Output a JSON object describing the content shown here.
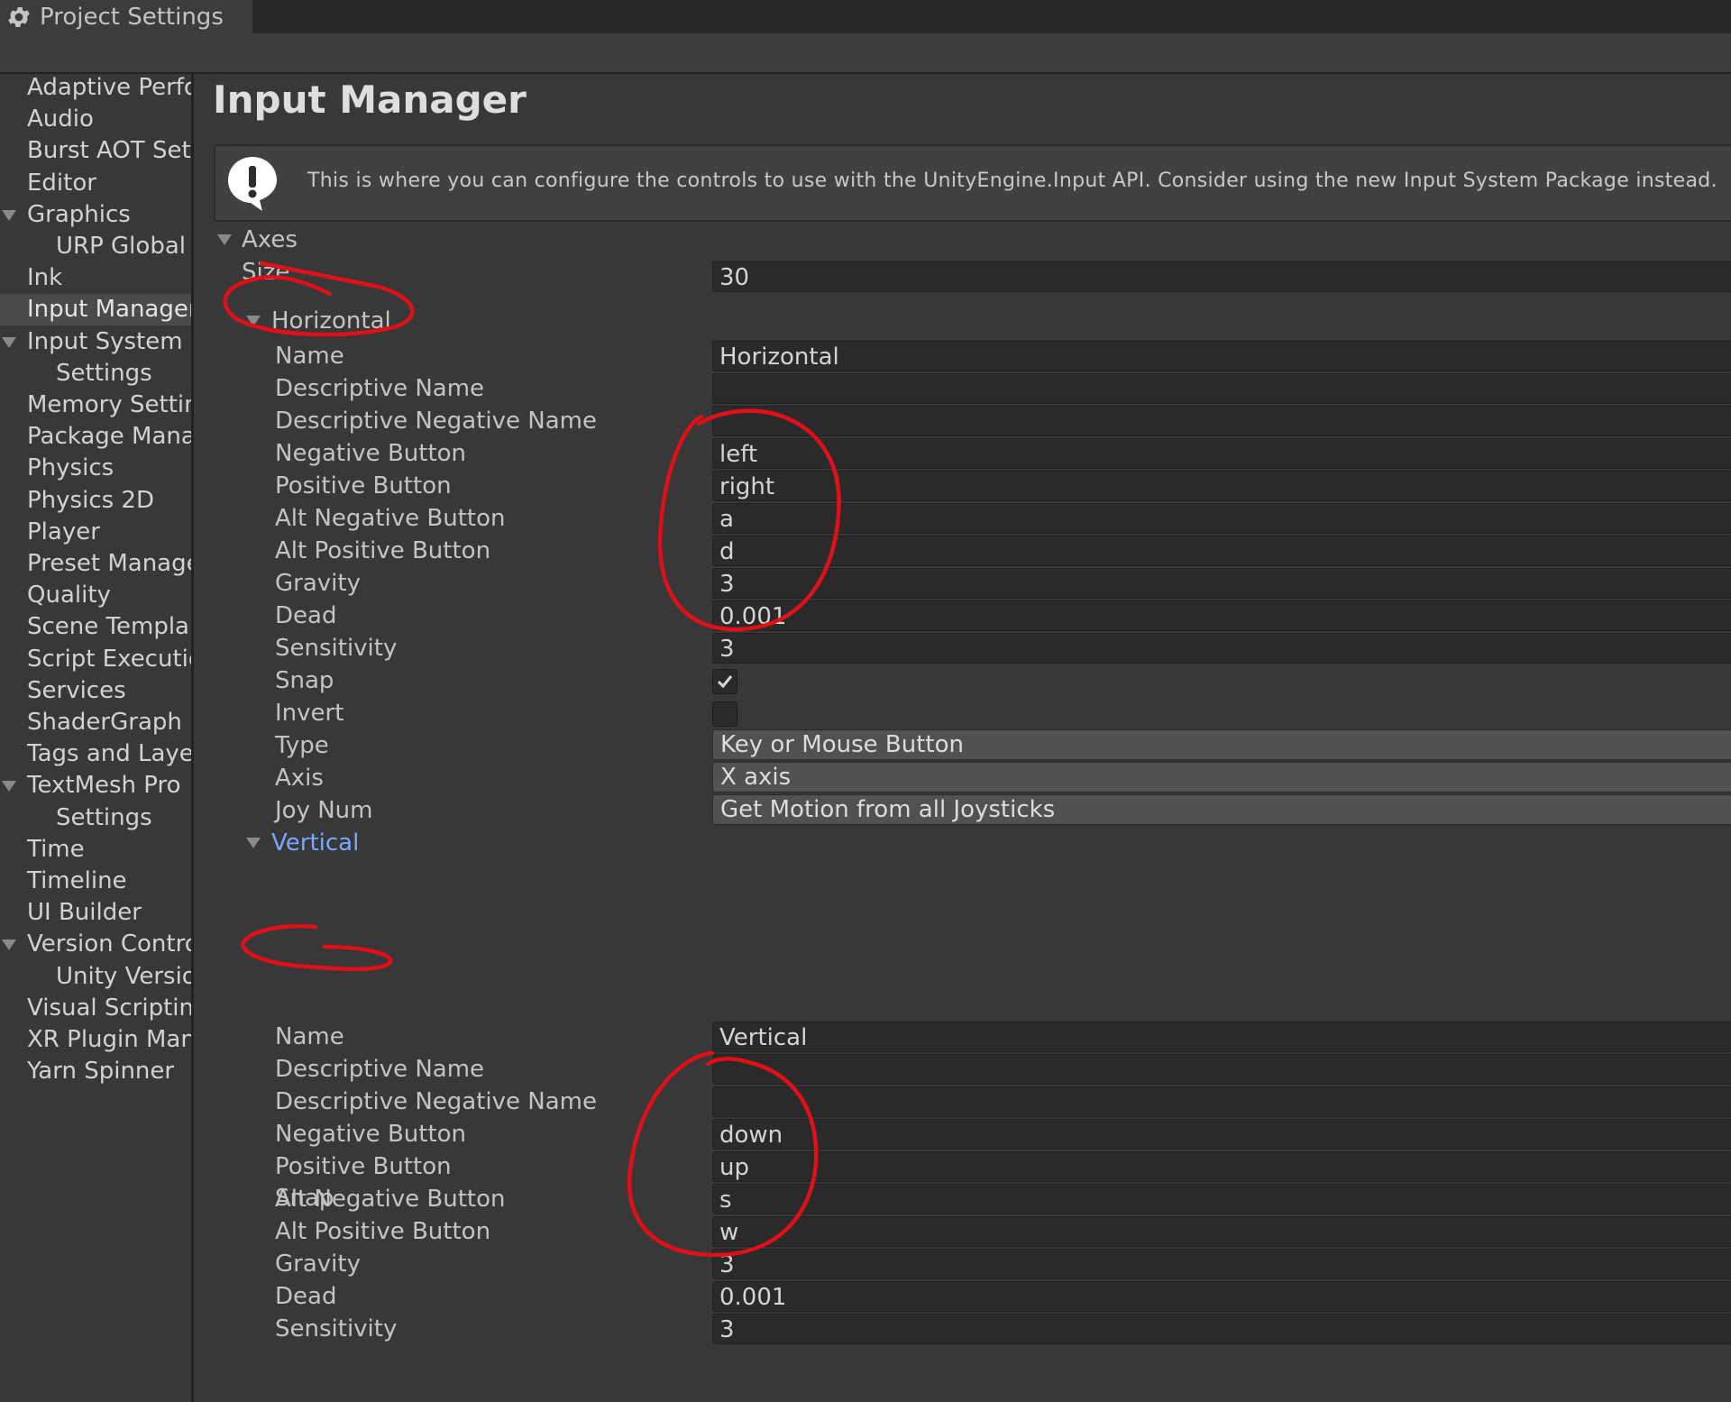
{
  "window": {
    "tab_title": "Project Settings"
  },
  "sidebar": {
    "items": [
      {
        "label": "Adaptive Perfo"
      },
      {
        "label": "Audio"
      },
      {
        "label": "Burst AOT Sett"
      },
      {
        "label": "Editor"
      },
      {
        "label": "Graphics",
        "expanded": true
      },
      {
        "label": "URP Global"
      },
      {
        "label": "Ink"
      },
      {
        "label": "Input Manager",
        "selected": true
      },
      {
        "label": "Input System F",
        "expanded": true
      },
      {
        "label": "Settings"
      },
      {
        "label": "Memory Settin"
      },
      {
        "label": "Package Mana"
      },
      {
        "label": "Physics"
      },
      {
        "label": "Physics 2D"
      },
      {
        "label": "Player"
      },
      {
        "label": "Preset Manage"
      },
      {
        "label": "Quality"
      },
      {
        "label": "Scene Templa"
      },
      {
        "label": "Script Executio"
      },
      {
        "label": "Services"
      },
      {
        "label": "ShaderGraph"
      },
      {
        "label": "Tags and Laye"
      },
      {
        "label": "TextMesh Pro",
        "expanded": true
      },
      {
        "label": "Settings"
      },
      {
        "label": "Time"
      },
      {
        "label": "Timeline"
      },
      {
        "label": "UI Builder"
      },
      {
        "label": "Version Contro",
        "expanded": true
      },
      {
        "label": "Unity Versio"
      },
      {
        "label": "Visual Scriptin"
      },
      {
        "label": "XR Plugin Man"
      },
      {
        "label": "Yarn Spinner"
      }
    ]
  },
  "main": {
    "title": "Input Manager",
    "help_message": "This is where you can configure the controls to use with the UnityEngine.Input API. Consider using the new Input System Package instead.",
    "axes_label": "Axes",
    "size_label": "Size",
    "size_value": "30",
    "horizontal": {
      "header": "Horizontal",
      "fields": [
        {
          "label": "Name",
          "value": "Horizontal"
        },
        {
          "label": "Descriptive Name",
          "value": ""
        },
        {
          "label": "Descriptive Negative Name",
          "value": ""
        },
        {
          "label": "Negative Button",
          "value": "left"
        },
        {
          "label": "Positive Button",
          "value": "right"
        },
        {
          "label": "Alt Negative Button",
          "value": "a"
        },
        {
          "label": "Alt Positive Button",
          "value": "d"
        },
        {
          "label": "Gravity",
          "value": "3"
        },
        {
          "label": "Dead",
          "value": "0.001"
        },
        {
          "label": "Sensitivity",
          "value": "3"
        }
      ],
      "snap_label": "Snap",
      "snap_checked": true,
      "invert_label": "Invert",
      "invert_checked": false,
      "type_label": "Type",
      "type_value": "Key or Mouse Button",
      "axis_label": "Axis",
      "axis_value": "X axis",
      "joynum_label": "Joy Num",
      "joynum_value": "Get Motion from all Joysticks"
    },
    "vertical": {
      "header": "Vertical",
      "fields": [
        {
          "label": "Name",
          "value": "Vertical"
        },
        {
          "label": "Descriptive Name",
          "value": ""
        },
        {
          "label": "Descriptive Negative Name",
          "value": ""
        },
        {
          "label": "Negative Button",
          "value": "down"
        },
        {
          "label": "Positive Button",
          "value": "up"
        },
        {
          "label": "Alt Negative Button",
          "value": "s"
        },
        {
          "label": "Alt Positive Button",
          "value": "w"
        },
        {
          "label": "Gravity",
          "value": "3"
        },
        {
          "label": "Dead",
          "value": "0.001"
        },
        {
          "label": "Sensitivity",
          "value": "3"
        }
      ],
      "snap_label": "Snap",
      "snap_checked": true
    }
  },
  "colors": {
    "background": "#383838",
    "field_bg": "#2a2a2a",
    "dropdown_bg": "#515151",
    "selected_row": "#4a4a4a",
    "link_blue": "#7ba7ff",
    "annotation_red": "#e0101a"
  },
  "icons": [
    "gear-icon",
    "warning-icon",
    "foldout-arrow-icon",
    "checkmark-icon"
  ]
}
